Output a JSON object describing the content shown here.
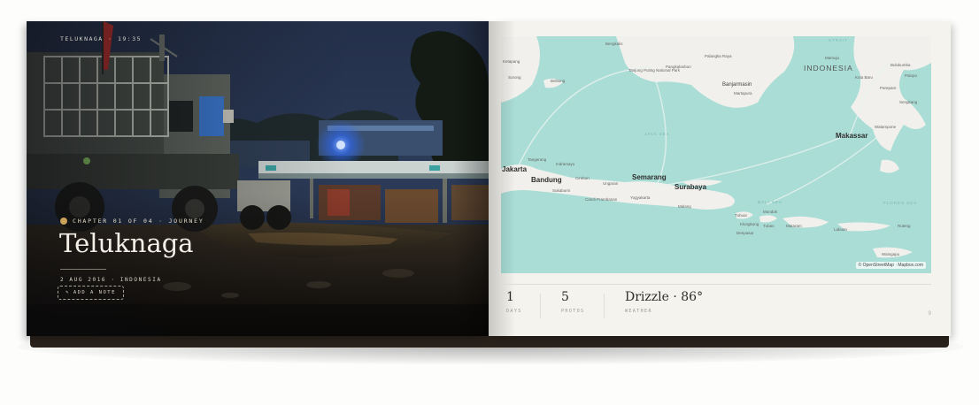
{
  "left_page": {
    "topline": "TELUKNAGA · 19:35",
    "chapter": "CHAPTER 01 OF 04 · JOURNEY",
    "title": "Teluknaga",
    "dateline": "2 AUG 2016 · INDONESIA",
    "add_note": "ADD A NOTE",
    "note_icon": "pencil-icon"
  },
  "map": {
    "attribution": "© OpenStreetMap · Mapbox.com",
    "country": "INDONESIA",
    "seas": [
      "JAVA SEA",
      "BALI SEA",
      "FLORES SEA",
      "STRAIT"
    ],
    "cities_major": [
      "Jakarta",
      "Bandung",
      "Semarang",
      "Surabaya",
      "Makassar",
      "Banjarmasin"
    ],
    "cities_minor": [
      "Tanjung Puting National Park",
      "Pangkalanbun",
      "Palangka Raya",
      "Martapura",
      "Cirebon",
      "Ungaran",
      "Yogyakarta",
      "Malang",
      "Candi Prambanan",
      "Sukabumi",
      "Indramayu",
      "Tubuai",
      "Mondok",
      "Klungkung",
      "Denpasar",
      "Tuban",
      "Kota Baru",
      "Mataram",
      "Palopo",
      "Parepare",
      "Sengkang",
      "Watampone",
      "Bulukumba",
      "Waingapu",
      "Ruteng",
      "Labuan",
      "Belitung",
      "Ketapang",
      "Mamuju",
      "Sorong",
      "Bengkalis",
      "Tangerang"
    ]
  },
  "stats": {
    "days_value": "1",
    "days_label": "DAYS",
    "photos_value": "5",
    "photos_label": "PHOTOS",
    "weather_value": "Drizzle · 86°",
    "weather_label": "WEATHER",
    "page_number": "9"
  },
  "colors": {
    "water": "#a9ddd6",
    "land": "#f1f0ec",
    "accent_dot": "#c9a35a",
    "spine": "#2a221b"
  }
}
